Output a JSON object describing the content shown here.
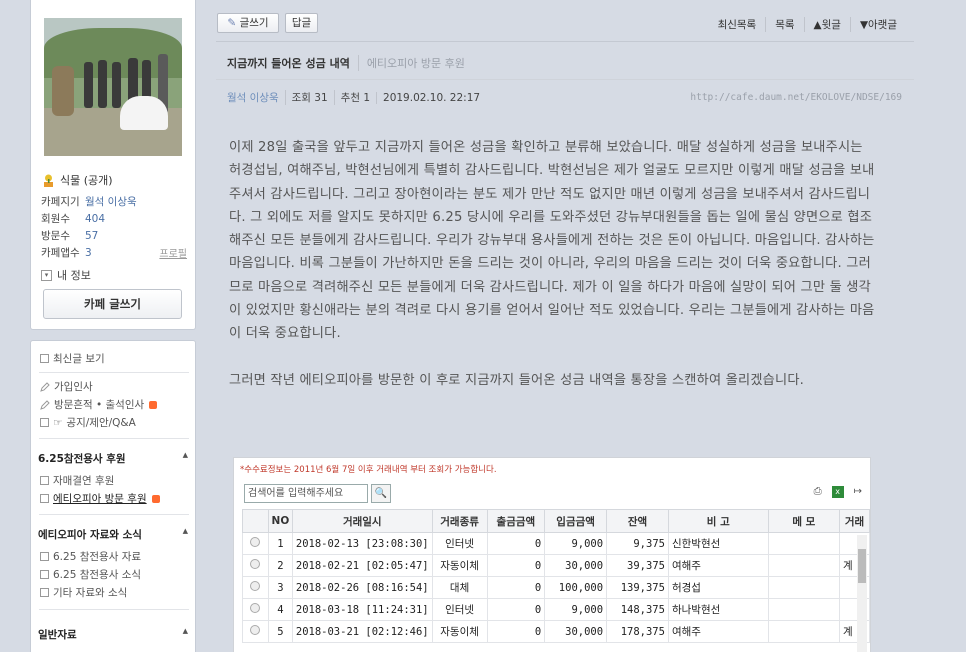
{
  "sidebar": {
    "level": "식물 (공개)",
    "info": [
      {
        "k": "카페지기",
        "v": "월석 이상욱"
      },
      {
        "k": "회원수",
        "v": "404"
      },
      {
        "k": "방문수",
        "v": "57"
      },
      {
        "k": "카페앱수",
        "v": "3",
        "link": "프로필"
      }
    ],
    "my_info": "내 정보",
    "write_btn": "카페 글쓰기",
    "menu": {
      "latest": "최신글 보기",
      "greet": "가입인사",
      "visit": "방문흔적 • 출석인사",
      "notice": "공지/제안/Q&A",
      "sec1": "6.25참전용사 후원",
      "sec1_items": [
        "자매결연 후원",
        "에티오피아 방문 후원"
      ],
      "sec2": "에티오피아 자료와 소식",
      "sec2_items": [
        "6.25 참전용사 자료",
        "6.25 참전용사 소식",
        "기타 자료와 소식"
      ],
      "sec3": "일반자료"
    }
  },
  "toolbar": {
    "write": "글쓰기",
    "reply": "답글",
    "latest": "최신목록",
    "list": "목록",
    "up": "▲윗글",
    "down": "▼아랫글"
  },
  "post": {
    "title": "지금까지 들어온 성금 내역",
    "board": "에티오피아 방문 후원",
    "author": "월석 이상욱",
    "views": "조회 31",
    "likes": "추천 1",
    "date": "2019.02.10. 22:17",
    "url": "http://cafe.daum.net/EKOLOVE/NDSE/169",
    "paragraphs": [
      "이제 28일 출국을 앞두고 지금까지 들어온 성금을 확인하고 분류해 보았습니다. 매달 성실하게 성금을 보내주시는 허경섭님, 여해주님, 박현선님에게 특별히 감사드립니다. 박현선님은 제가 얼굴도 모르지만 이렇게 매달 성금을 보내주셔서 감사드립니다. 그리고 장아현이라는 분도 제가 만난 적도 없지만 매년 이렇게 성금을 보내주셔서 감사드립니다. 그 외에도 저를 알지도 못하지만 6.25 당시에 우리를 도와주셨던 강뉴부대원들을 돕는 일에 물심 양면으로 협조해주신 모든 분들에게 감사드립니다. 우리가 강뉴부대 용사들에게 전하는 것은 돈이 아닙니다. 마음입니다. 감사하는 마음입니다. 비록 그분들이 가난하지만 돈을 드리는 것이 아니라, 우리의 마음을 드리는 것이 더욱 중요합니다. 그러므로 마음으로 격려해주신 모든 분들에게 더욱 감사드립니다. 제가 이 일을 하다가 마음에 실망이 되어 그만 둘 생각이 있었지만 황신애라는 분의 격려로 다시 용기를 얻어서 일어난 적도 있었습니다. 우리는 그분들에게 감사하는 마음이 더욱 중요합니다.",
      "그러면 작년 에티오피아를 방문한 이 후로 지금까지 들어온 성금 내역을 통장을 스캔하여 올리겠습니다."
    ]
  },
  "scan": {
    "note": "*수수료정보는 2011년 6월 7일 이후 거래내역 부터 조회가 가능합니다.",
    "search_placeholder": "검색어를 입력해주세요",
    "headers": [
      "NO",
      "거래일시",
      "거래종류",
      "출금금액",
      "입금금액",
      "잔액",
      "비 고",
      "메 모",
      "거래"
    ],
    "rows": [
      {
        "no": "1",
        "dt": "2018-02-13 [23:08:30]",
        "type": "인터넷",
        "out": "0",
        "in": "9,000",
        "bal": "9,375",
        "note": "신한박현선",
        "memo": "",
        "extra": ""
      },
      {
        "no": "2",
        "dt": "2018-02-21 [02:05:47]",
        "type": "자동이체",
        "out": "0",
        "in": "30,000",
        "bal": "39,375",
        "note": "여해주",
        "memo": "",
        "extra": "계"
      },
      {
        "no": "3",
        "dt": "2018-02-26 [08:16:54]",
        "type": "대체",
        "out": "0",
        "in": "100,000",
        "bal": "139,375",
        "note": "허경섭",
        "memo": "",
        "extra": ""
      },
      {
        "no": "4",
        "dt": "2018-03-18 [11:24:31]",
        "type": "인터넷",
        "out": "0",
        "in": "9,000",
        "bal": "148,375",
        "note": "하나박현선",
        "memo": "",
        "extra": ""
      },
      {
        "no": "5",
        "dt": "2018-03-21 [02:12:46]",
        "type": "자동이체",
        "out": "0",
        "in": "30,000",
        "bal": "178,375",
        "note": "여해주",
        "memo": "",
        "extra": "계"
      }
    ]
  }
}
